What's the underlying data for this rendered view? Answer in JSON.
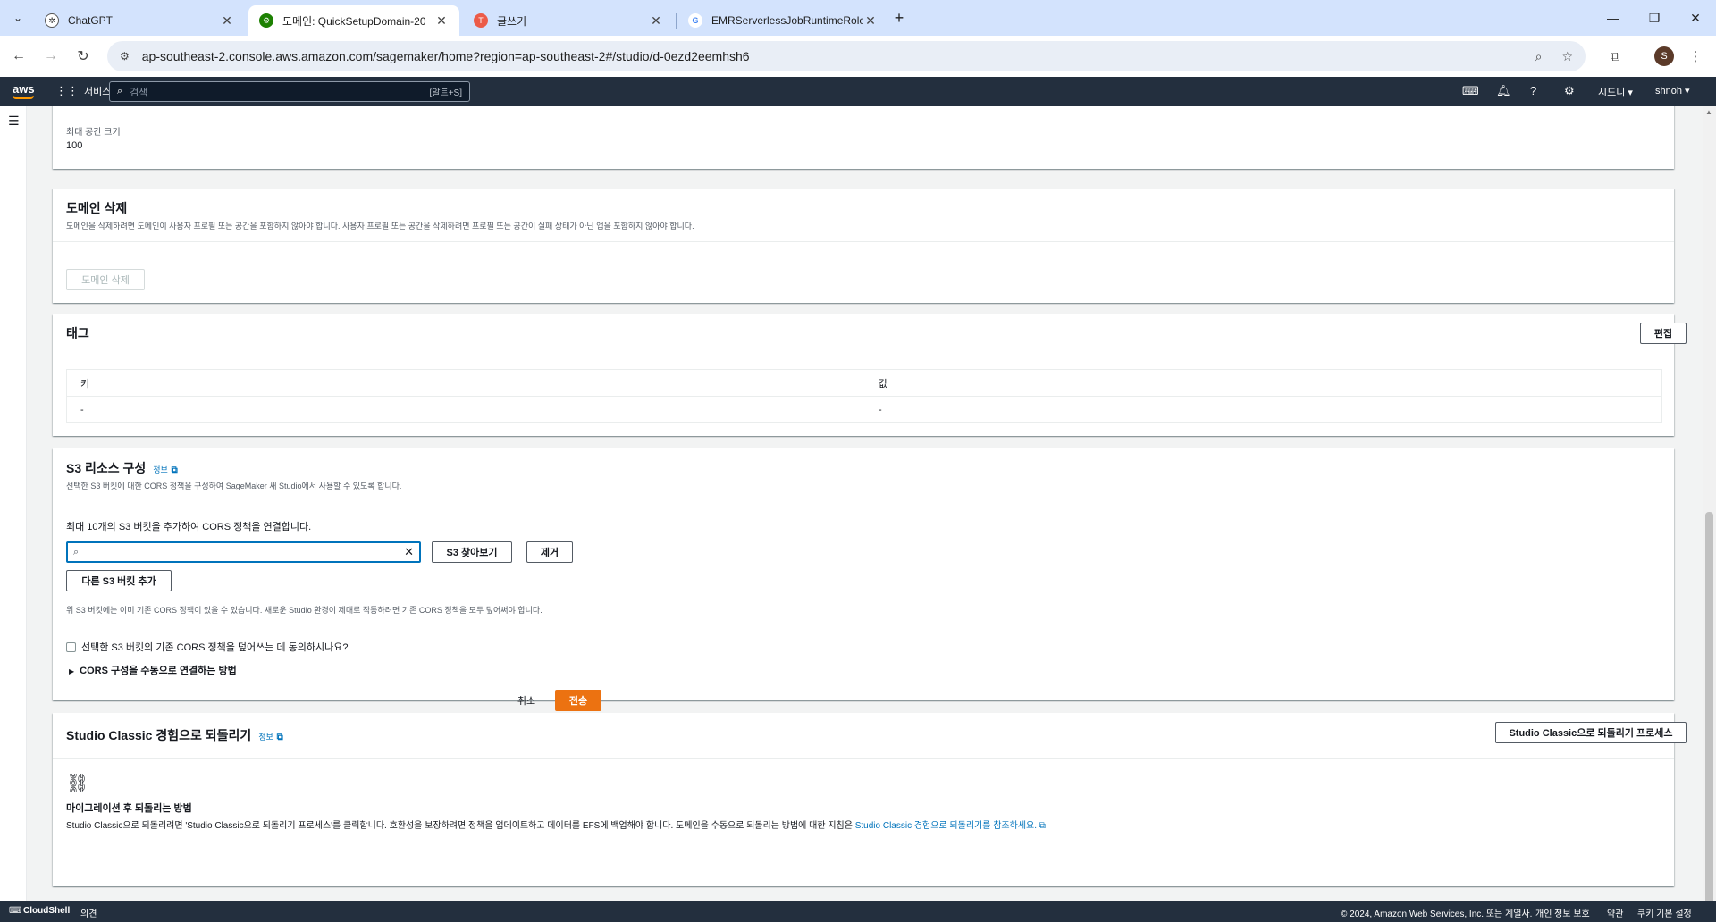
{
  "browser": {
    "tabs": [
      {
        "title": "ChatGPT",
        "active": false
      },
      {
        "title": "도메인: QuickSetupDomain-20",
        "active": true
      },
      {
        "title": "글쓰기",
        "active": false
      },
      {
        "title": "EMRServerlessJobRuntimeRole",
        "active": false
      }
    ],
    "url": "ap-southeast-2.console.aws.amazon.com/sagemaker/home?region=ap-southeast-2#/studio/d-0ezd2eemhsh6",
    "profile_initial": "S"
  },
  "awsnav": {
    "logo": "aws",
    "services": "서비스",
    "search_placeholder": "검색",
    "search_shortcut": "[알트+S]",
    "region": "시드니 ▾",
    "user": "shnoh ▾"
  },
  "max_space": {
    "label": "최대 공간 크기",
    "value": "100"
  },
  "delete_domain": {
    "title": "도메인 삭제",
    "description": "도메인을 삭제하려면 도메인이 사용자 프로필 또는 공간을 포함하지 않아야 합니다. 사용자 프로필 또는 공간을 삭제하려면 프로필 또는 공간이 실패 상태가 아닌 앱을 포함하지 않아야 합니다.",
    "button": "도메인 삭제"
  },
  "tags": {
    "title": "태그",
    "edit_button": "편집",
    "columns": [
      "키",
      "값"
    ],
    "rows": [
      [
        "-",
        "-"
      ]
    ]
  },
  "s3": {
    "title": "S3 리소스 구성",
    "info": "정보",
    "description": "선택한 S3 버킷에 대한 CORS 정책을 구성하여 SageMaker 새 Studio에서 사용할 수 있도록 합니다.",
    "instruction": "최대 10개의 S3 버킷을 추가하여 CORS 정책을 연결합니다.",
    "input_value": "",
    "browse_button": "S3 찾아보기",
    "remove_button": "제거",
    "add_button": "다른 S3 버킷 추가",
    "warning": "위 S3 버킷에는 이미 기존 CORS 정책이 있을 수 있습니다. 새로운 Studio 환경이 제대로 작동하려면 기존 CORS 정책을 모두 덮어써야 합니다.",
    "checkbox_label": "선택한 S3 버킷의 기존 CORS 정책을 덮어쓰는 데 동의하시나요?",
    "expander": "CORS 구성을 수동으로 연결하는 방법",
    "cancel": "취소",
    "submit": "전송"
  },
  "classic": {
    "title": "Studio Classic 경험으로 되돌리기",
    "info": "정보",
    "revert_button": "Studio Classic으로 되돌리기 프로세스",
    "subtitle": "마이그레이션 후 되돌리는 방법",
    "body": "Studio Classic으로 되돌리려면 'Studio Classic으로 되돌리기 프로세스'를 클릭합니다. 호환성을 보장하려면 정책을 업데이트하고 데이터를 EFS에 백업해야 합니다. 도메인을 수동으로 되돌리는 방법에 대한 지침은 ",
    "link": "Studio Classic 경험으로 되돌리기를 참조하세요."
  },
  "footer": {
    "cloudshell": "CloudShell",
    "feedback": "의견",
    "copyright": "© 2024, Amazon Web Services, Inc. 또는 계열사.",
    "privacy": "개인 정보 보호",
    "terms": "약관",
    "cookies": "쿠키 기본 설정"
  },
  "colors": {
    "aws_nav": "#232f3e",
    "primary_button": "#ec7211",
    "link": "#0073bb",
    "content_bg": "#f2f3f3"
  }
}
